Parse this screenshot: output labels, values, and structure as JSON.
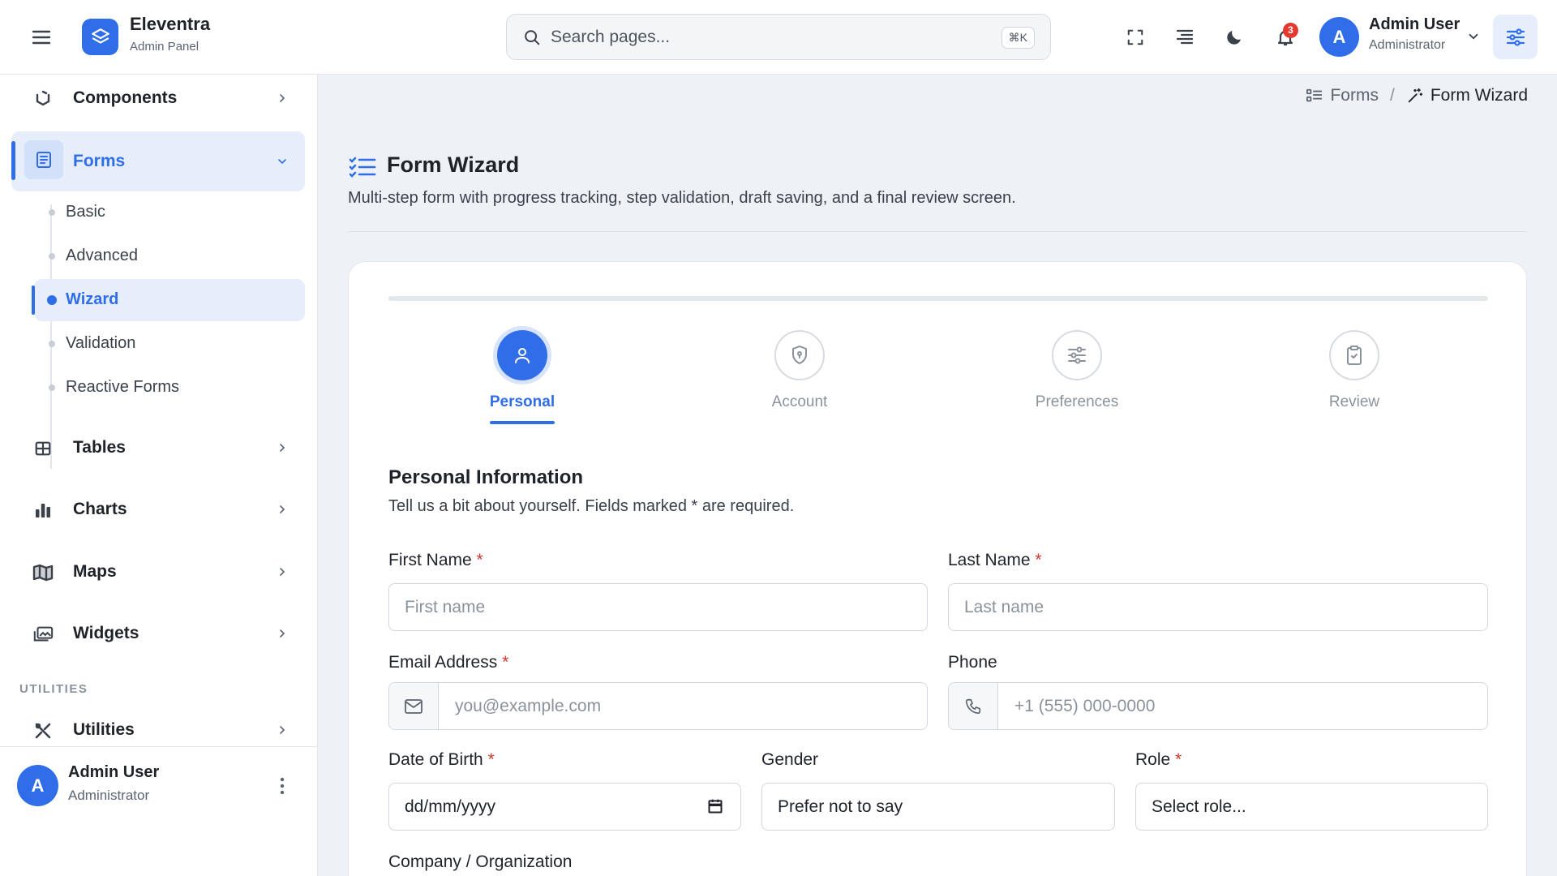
{
  "header": {
    "brand_name": "Eleventra",
    "brand_sub": "Admin Panel",
    "search_placeholder": "Search pages...",
    "search_shortcut": "⌘K",
    "notification_count": "3",
    "user_initial": "A",
    "user_name": "Admin User",
    "user_role": "Administrator"
  },
  "sidebar": {
    "items": [
      {
        "label": "Components",
        "icon": "components-icon"
      },
      {
        "label": "Forms",
        "icon": "forms-icon",
        "active": true
      },
      {
        "label": "Tables",
        "icon": "table-icon"
      },
      {
        "label": "Charts",
        "icon": "bar-chart-icon"
      },
      {
        "label": "Maps",
        "icon": "map-icon"
      },
      {
        "label": "Widgets",
        "icon": "widgets-icon"
      },
      {
        "label": "Utilities",
        "icon": "tools-icon"
      }
    ],
    "forms_sub": [
      {
        "label": "Basic"
      },
      {
        "label": "Advanced"
      },
      {
        "label": "Wizard",
        "active": true
      },
      {
        "label": "Validation"
      },
      {
        "label": "Reactive Forms"
      }
    ],
    "section_utilities": "UTILITIES",
    "footer": {
      "initial": "A",
      "name": "Admin User",
      "role": "Administrator"
    }
  },
  "breadcrumb": {
    "parent": "Forms",
    "separator": "/",
    "current": "Form Wizard"
  },
  "page": {
    "title": "Form Wizard",
    "description": "Multi-step form with progress tracking, step validation, draft saving, and a final review screen."
  },
  "wizard": {
    "progress": 0,
    "steps": [
      {
        "label": "Personal",
        "icon": "user-icon",
        "active": true
      },
      {
        "label": "Account",
        "icon": "shield-icon"
      },
      {
        "label": "Preferences",
        "icon": "sliders-icon"
      },
      {
        "label": "Review",
        "icon": "clipboard-icon"
      }
    ]
  },
  "form": {
    "section_title": "Personal Information",
    "section_desc": "Tell us a bit about yourself. Fields marked * are required.",
    "required_mark": "*",
    "first_name": {
      "label": "First Name",
      "placeholder": "First name"
    },
    "last_name": {
      "label": "Last Name",
      "placeholder": "Last name"
    },
    "email": {
      "label": "Email Address",
      "placeholder": "you@example.com"
    },
    "phone": {
      "label": "Phone",
      "placeholder": "+1 (555) 000-0000"
    },
    "dob": {
      "label": "Date of Birth",
      "value": "dd/mm/yyyy"
    },
    "gender": {
      "label": "Gender",
      "value": "Prefer not to say"
    },
    "role": {
      "label": "Role",
      "value": "Select role..."
    },
    "company": {
      "label": "Company / Organization"
    }
  },
  "colors": {
    "accent": "#2f6de9",
    "required": "#d1362d",
    "badge": "#e5392f"
  }
}
